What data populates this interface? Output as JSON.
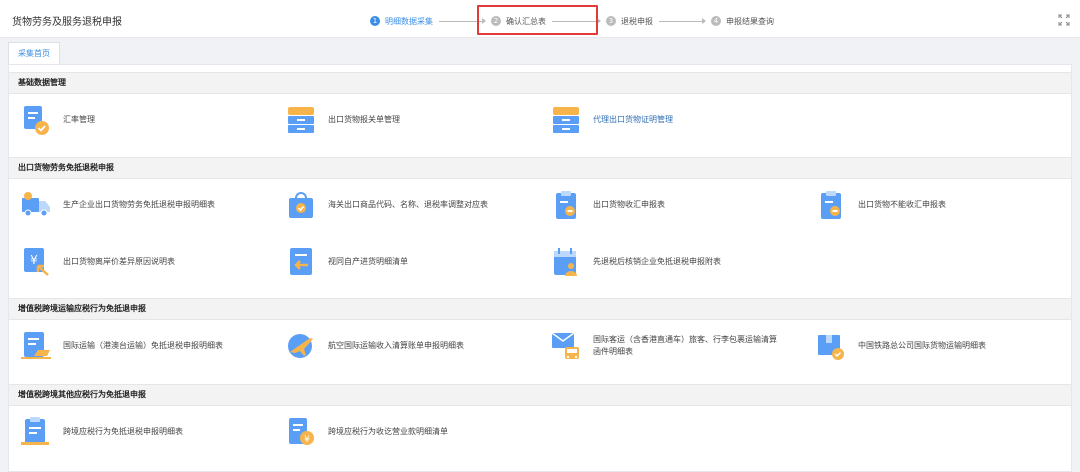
{
  "header": {
    "title": "货物劳务及服务退税申报",
    "steps": [
      {
        "num": "1",
        "label": "明细数据采集"
      },
      {
        "num": "2",
        "label": "确认汇总表"
      },
      {
        "num": "3",
        "label": "退税申报"
      },
      {
        "num": "4",
        "label": "申报结果查询"
      }
    ],
    "fullscreen_icon": "fullscreen-icon"
  },
  "tabs": [
    {
      "label": "采集首页"
    }
  ],
  "sections": [
    {
      "title": "基础数据管理",
      "items": [
        {
          "label": "汇率管理",
          "icon": "exchange-rate-doc-icon"
        },
        {
          "label": "出口货物报关单管理",
          "icon": "cabinet-icon"
        },
        {
          "label": "代理出口货物证明管理",
          "icon": "cabinet-icon"
        }
      ]
    },
    {
      "title": "出口货物劳务免抵退税申报",
      "items": [
        {
          "label": "生产企业出口货物劳务免抵退税申报明细表",
          "icon": "truck-icon"
        },
        {
          "label": "海关出口商品代码、名称、退税率调整对应表",
          "icon": "shopping-bag-icon"
        },
        {
          "label": "出口货物收汇申报表",
          "icon": "clipboard-icon"
        },
        {
          "label": "出口货物不能收汇申报表",
          "icon": "clipboard-minus-icon"
        },
        {
          "label": "出口货物离岸价差异原因说明表",
          "icon": "yen-doc-icon"
        },
        {
          "label": "视同自产进货明细清单",
          "icon": "import-doc-icon"
        },
        {
          "label": "先退税后核销企业免抵退税申报附表",
          "icon": "calendar-user-icon"
        }
      ]
    },
    {
      "title": "增值税跨境运输应税行为免抵退申报",
      "items": [
        {
          "label": "国际运输（港澳台运输）免抵退税申报明细表",
          "icon": "ship-doc-icon"
        },
        {
          "label": "航空国际运输收入清算账单申报明细表",
          "icon": "airplane-globe-icon"
        },
        {
          "label": "国际客运（含香港直通车）旅客、行李包裹运输清算函件明细表",
          "icon": "mail-bus-icon"
        },
        {
          "label": "中国铁路总公司国际货物运输明细表",
          "icon": "package-check-icon"
        }
      ]
    },
    {
      "title": "增值税跨境其他应税行为免抵退申报",
      "items": [
        {
          "label": "跨境应税行为免抵退税申报明细表",
          "icon": "doc-check-icon"
        },
        {
          "label": "跨境应税行为收讫营业款明细清单",
          "icon": "doc-yen-icon"
        }
      ]
    }
  ],
  "colors": {
    "icon_blue": "#5b9ef5",
    "icon_blue_light": "#bcd8fb",
    "icon_orange": "#f6b44b",
    "accent": "#3a8ee6",
    "highlight": "#e23b3b"
  }
}
